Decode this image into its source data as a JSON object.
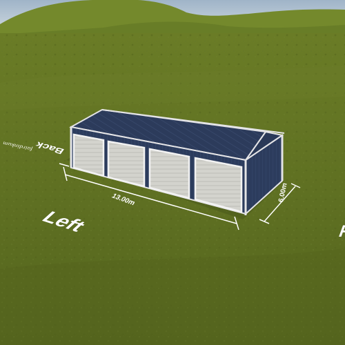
{
  "scene": {
    "side_labels": {
      "left": "Left",
      "back": "Back",
      "right": "R"
    },
    "dimensions": {
      "length": "13.00m",
      "width": "6.00m"
    },
    "watermark": "fairdinkum"
  },
  "building": {
    "roller_doors": 4,
    "wall_color": "#2d3d5e",
    "roof_color": "#2b3a5a",
    "trim_color": "#e8e8ea",
    "door_color": "#d2d2cc"
  },
  "colors": {
    "sky": "#b9c8d6",
    "grass": "#5d6e22",
    "hills": "#6b7f2a"
  }
}
